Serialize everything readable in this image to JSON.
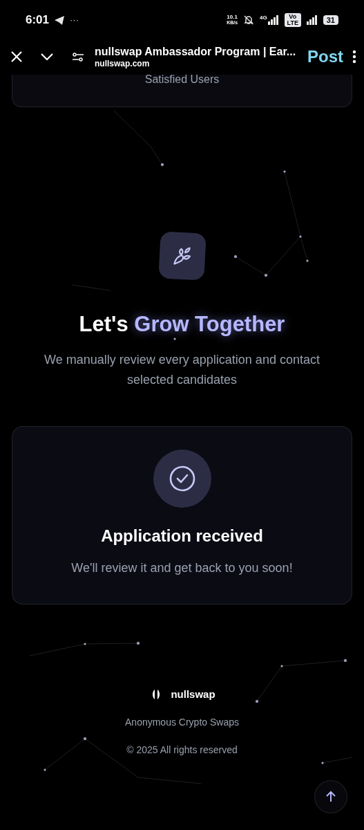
{
  "status_bar": {
    "time": "6:01",
    "more": "···",
    "speed": "10.1",
    "speed_unit": "KB/s",
    "network": "4G",
    "volte": "Vo LTE",
    "battery": "31"
  },
  "browser_bar": {
    "title": "nullswap Ambassador Program | Ear...",
    "url": "nullswap.com",
    "action": "Post"
  },
  "stat_card": {
    "label": "Satisfied Users"
  },
  "hero": {
    "heading_plain": "Let's ",
    "heading_accent": "Grow Together",
    "subtitle": "We manually review every application and contact selected candidates"
  },
  "confirmation": {
    "title": "Application received",
    "message": "We'll review it and get back to you soon!"
  },
  "footer": {
    "brand": "nullswap",
    "tagline": "Anonymous Crypto Swaps",
    "copyright": "© 2025 All rights reserved"
  }
}
